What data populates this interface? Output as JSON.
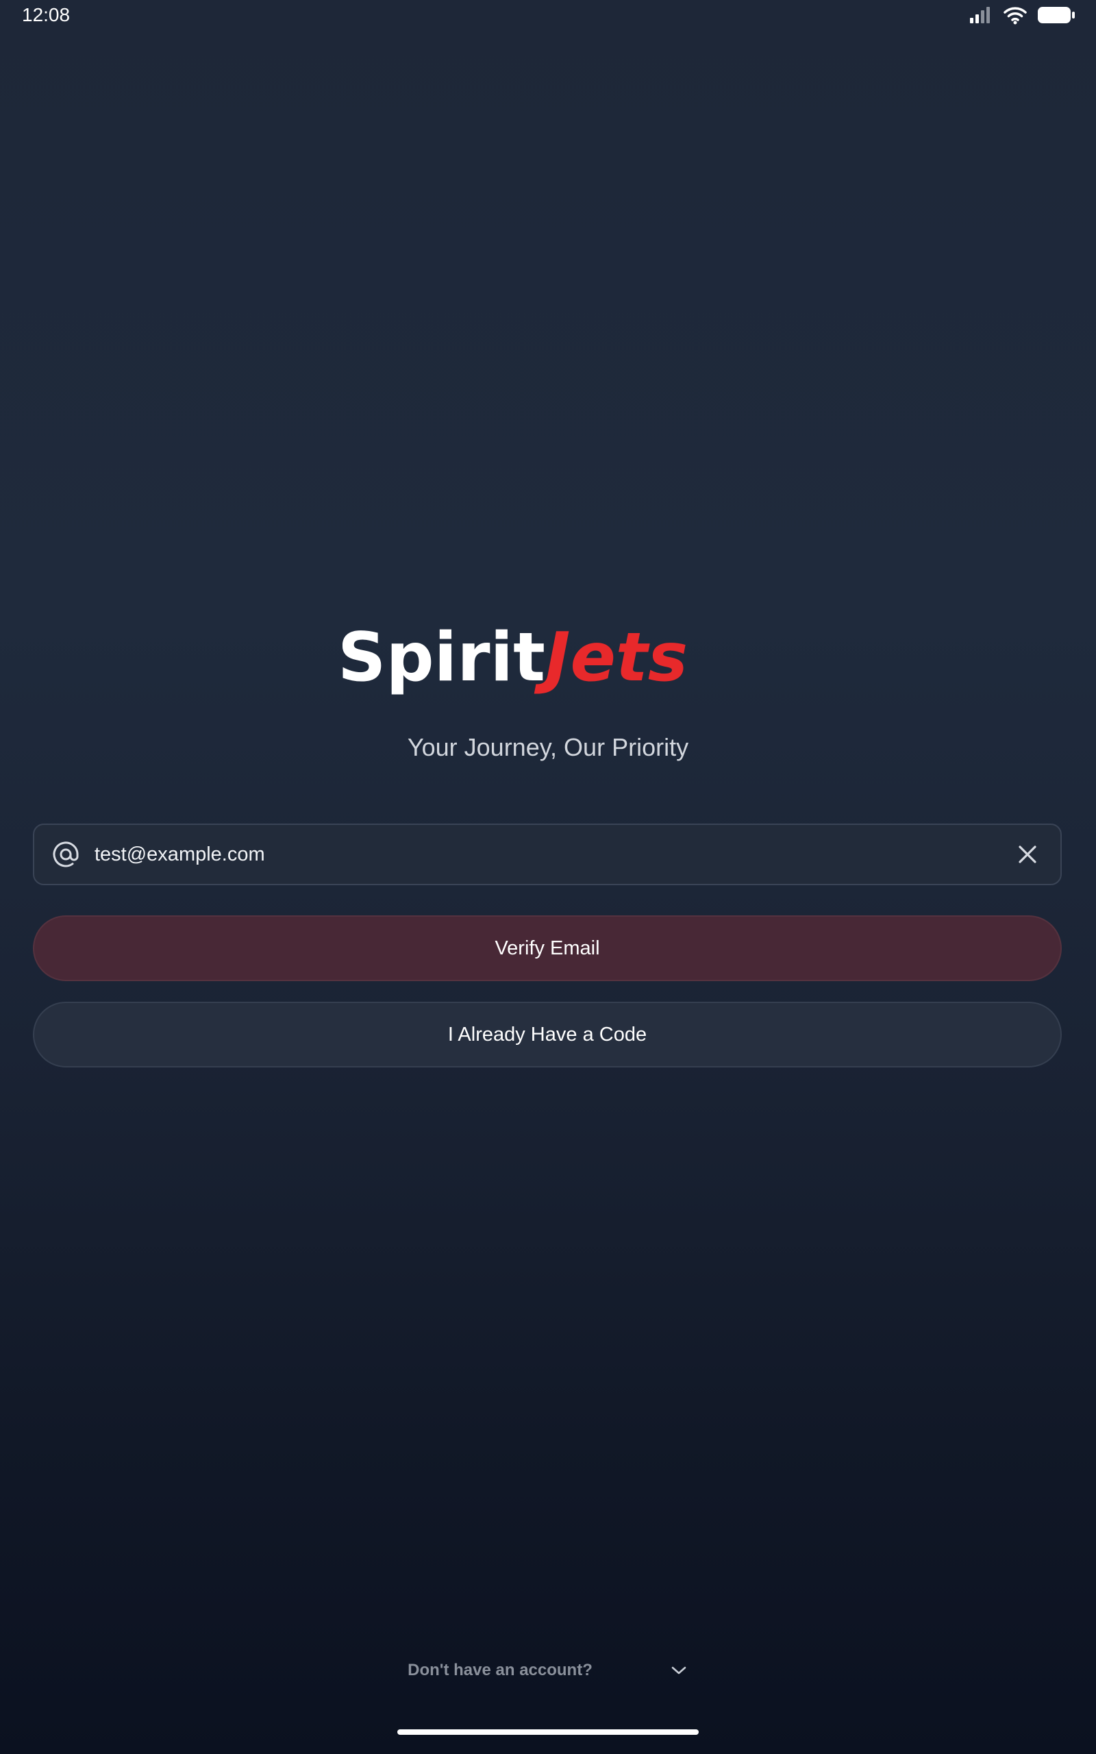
{
  "status_bar": {
    "time": "12:08",
    "icons": [
      "signal-icon",
      "wifi-icon",
      "battery-icon"
    ]
  },
  "brand": {
    "logo_part1": "Spirit",
    "logo_part2": "Jets",
    "accent_color": "#e8292b",
    "tagline": "Your Journey, Our Priority"
  },
  "email_input": {
    "value": "test@example.com",
    "leading_icon": "at-icon",
    "trailing_icon": "close-icon"
  },
  "buttons": {
    "verify_label": "Verify Email",
    "code_label": "I Already Have a Code"
  },
  "footer": {
    "signup_prompt": "Don't have an account?",
    "expand_icon": "chevron-down-icon"
  }
}
